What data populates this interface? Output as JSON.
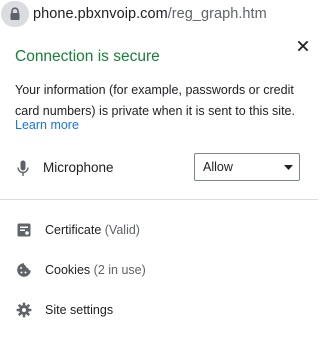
{
  "omnibox": {
    "url_host": "phone.pbxnvoip.com",
    "url_path": "/reg_graph.htm",
    "lock_icon": "lock-icon"
  },
  "popup": {
    "close_icon": "close-icon",
    "title": "Connection is secure",
    "description": "Your information (for example, passwords or credit card numbers) is private when it is sent to this site.",
    "learn_more": "Learn more",
    "permission": {
      "icon": "microphone-icon",
      "label": "Microphone",
      "value": "Allow"
    },
    "links": [
      {
        "icon": "certificate-icon",
        "label": "Certificate",
        "sub": "(Valid)"
      },
      {
        "icon": "cookie-icon",
        "label": "Cookies",
        "sub": "(2 in use)"
      },
      {
        "icon": "gear-icon",
        "label": "Site settings",
        "sub": ""
      }
    ]
  },
  "colors": {
    "secure_green": "#188038",
    "link_blue": "#1a73e8",
    "icon_grey": "#5f6368",
    "chip_grey": "#dadce0"
  }
}
